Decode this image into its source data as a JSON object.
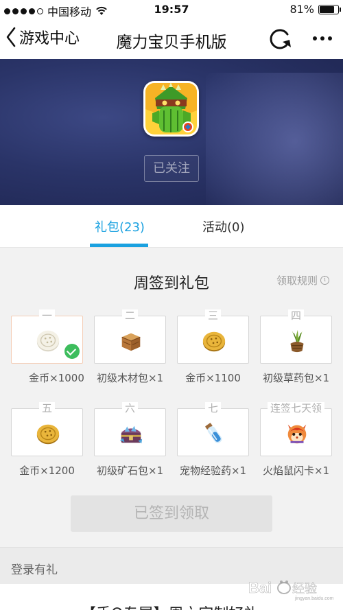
{
  "status_bar": {
    "carrier": "中国移动",
    "time": "19:57",
    "battery": "81%",
    "battery_level": 0.81
  },
  "nav": {
    "back_label": "游戏中心",
    "title": "魔力宝贝手机版"
  },
  "hero": {
    "follow_label": "已关注"
  },
  "tabs": [
    {
      "label": "礼包(23)",
      "active": true
    },
    {
      "label": "活动(0)",
      "active": false
    }
  ],
  "weekly": {
    "title": "周签到礼包",
    "rules_label": "领取规则",
    "items": [
      {
        "day": "一",
        "name": "金币×1000",
        "icon": "silver-coin-icon",
        "claimed": true
      },
      {
        "day": "二",
        "name": "初级木材包×1",
        "icon": "wood-crate-icon",
        "claimed": false
      },
      {
        "day": "三",
        "name": "金币×1100",
        "icon": "gold-coin-icon",
        "claimed": false
      },
      {
        "day": "四",
        "name": "初级草药包×1",
        "icon": "herb-pack-icon",
        "claimed": false
      },
      {
        "day": "五",
        "name": "金币×1200",
        "icon": "gold-coin-icon",
        "claimed": false
      },
      {
        "day": "六",
        "name": "初级矿石包×1",
        "icon": "ore-chest-icon",
        "claimed": false
      },
      {
        "day": "七",
        "name": "宠物经验药×1",
        "icon": "potion-vial-icon",
        "claimed": false
      },
      {
        "day": "连签七天领",
        "name": "火焰鼠闪卡×1",
        "icon": "fire-rat-card-icon",
        "claimed": false
      }
    ],
    "claim_button": "已签到领取"
  },
  "login_section": {
    "title": "登录有礼"
  },
  "bottom_text": "【手Q专属】周六定制好礼",
  "watermark": "Baidu经验",
  "colors": {
    "accent": "#1aa1e0",
    "claimed_check": "#3dbd5d"
  }
}
